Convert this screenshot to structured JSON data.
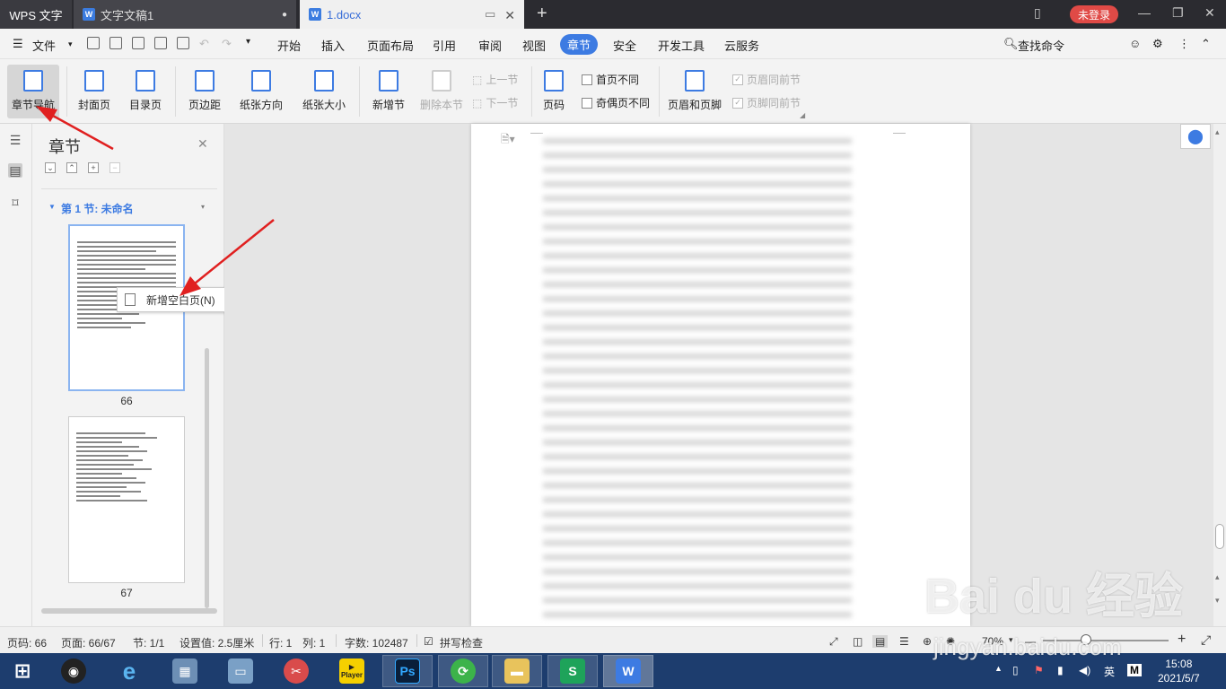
{
  "titlebar": {
    "app": "WPS 文字",
    "tab1": "文字文稿1",
    "tab2": "1.docx",
    "login": "未登录"
  },
  "menu": {
    "file": "文件",
    "items": [
      "开始",
      "插入",
      "页面布局",
      "引用",
      "审阅",
      "视图",
      "章节",
      "安全",
      "开发工具",
      "云服务"
    ],
    "active": "章节",
    "search": "查找命令"
  },
  "ribbon": {
    "nav": "章节导航",
    "cover": "封面页",
    "toc": "目录页",
    "margin": "页边距",
    "orient": "纸张方向",
    "size": "纸张大小",
    "newsec": "新增节",
    "delsec": "删除本节",
    "prevsec": "上一节",
    "nextsec": "下一节",
    "pagenum": "页码",
    "firstdiff": "首页不同",
    "oddeven": "奇偶页不同",
    "headerfooter": "页眉和页脚",
    "hdrsame": "页眉同前节",
    "ftrsame": "页脚同前节"
  },
  "panel": {
    "title": "章节",
    "section": "第 1 节: 未命名",
    "pages": [
      "66",
      "67"
    ],
    "context_item": "新增空白页(N)"
  },
  "status": {
    "page": "页码: 66",
    "pages": "页面: 66/67",
    "section": "节: 1/1",
    "setting": "设置值: 2.5厘米",
    "row": "行: 1",
    "col": "列: 1",
    "words": "字数: 102487",
    "spell": "拼写检查",
    "zoom": "70%"
  },
  "taskbar": {
    "ps": "Ps",
    "s": "S",
    "w": "W",
    "player": "Player",
    "ime": "英",
    "m": "M",
    "time": "15:08",
    "date": "2021/5/7"
  },
  "watermark": {
    "brand": "Bai du 经验",
    "url": "jingyan.baidu.com"
  },
  "colors": {
    "accent": "#3d7be2",
    "login": "#e04a46",
    "taskbar": "#1d3d6e",
    "arrow": "#e02020"
  }
}
